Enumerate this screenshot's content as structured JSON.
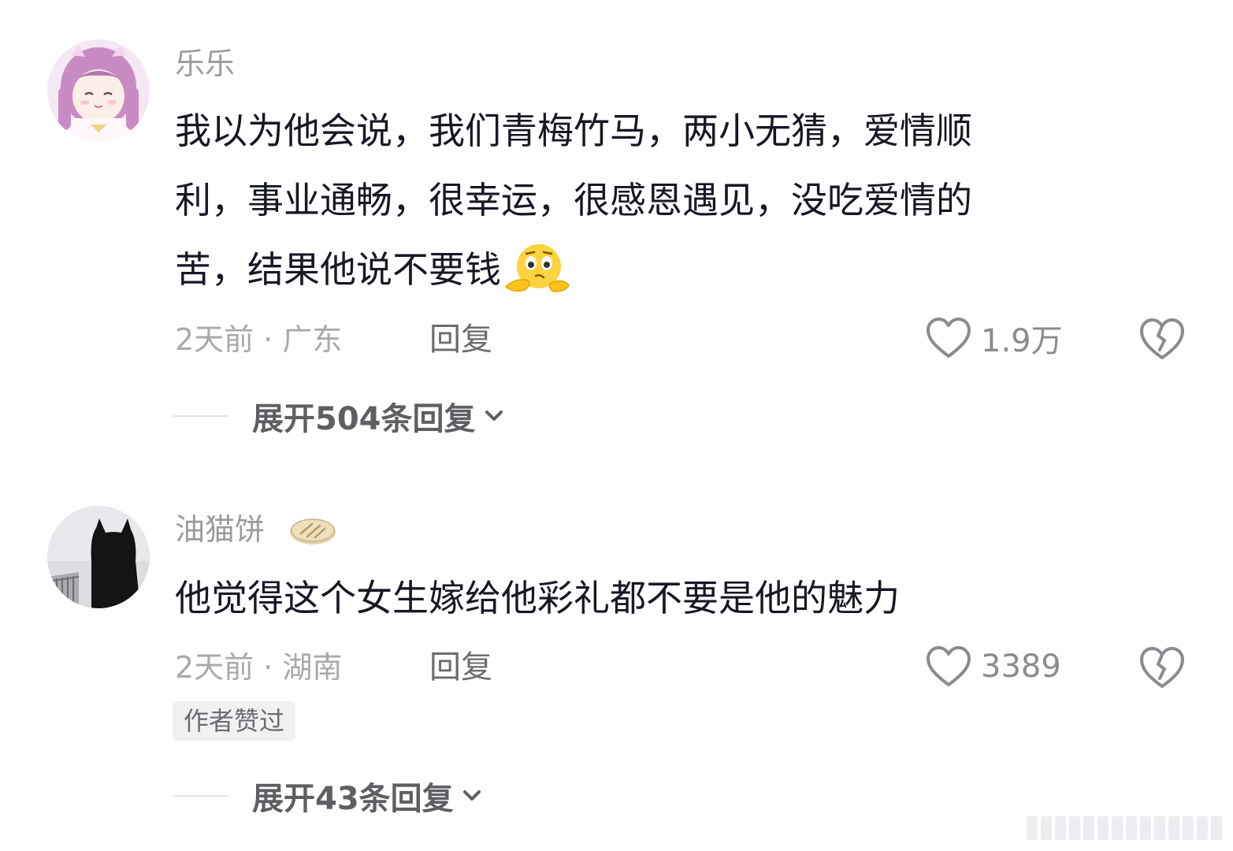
{
  "comments": [
    {
      "username": "乐乐",
      "avatar_icon": "anime-girl-avatar-icon",
      "text": "我以为他会说，我们青梅竹马，两小无猜，爱情顺利，事业通畅，很幸运，很感恩遇见，没吃爱情的苦，结果他说不要钱",
      "text_lines": [
        "我以为他会说，我们青梅竹马，两小无猜，爱情顺",
        "利，事业通畅，很幸运，很感恩遇见，没吃爱情的",
        "苦，结果他说不要钱"
      ],
      "emoji": "thinking-face-emoji",
      "meta": "2天前 · 广东",
      "reply_label": "回复",
      "like_count": "1.9万",
      "expand_label": "展开504条回复"
    },
    {
      "username": "油猫饼",
      "avatar_icon": "black-cat-avatar-icon",
      "username_badge_icon": "pancake-icon",
      "text": "他觉得这个女生嫁给他彩礼都不要是他的魅力",
      "meta": "2天前 · 湖南",
      "reply_label": "回复",
      "like_count": "3389",
      "author_badge": "作者赞过",
      "expand_label": "展开43条回复"
    }
  ],
  "icons": {
    "like": "heart-outline-icon",
    "dislike": "broken-heart-icon",
    "expand": "chevron-down-icon"
  },
  "colors": {
    "text_primary": "#161823",
    "text_secondary": "#a8a8ad",
    "expand_text": "#5e5e63",
    "badge_bg": "#f1f1f3"
  }
}
